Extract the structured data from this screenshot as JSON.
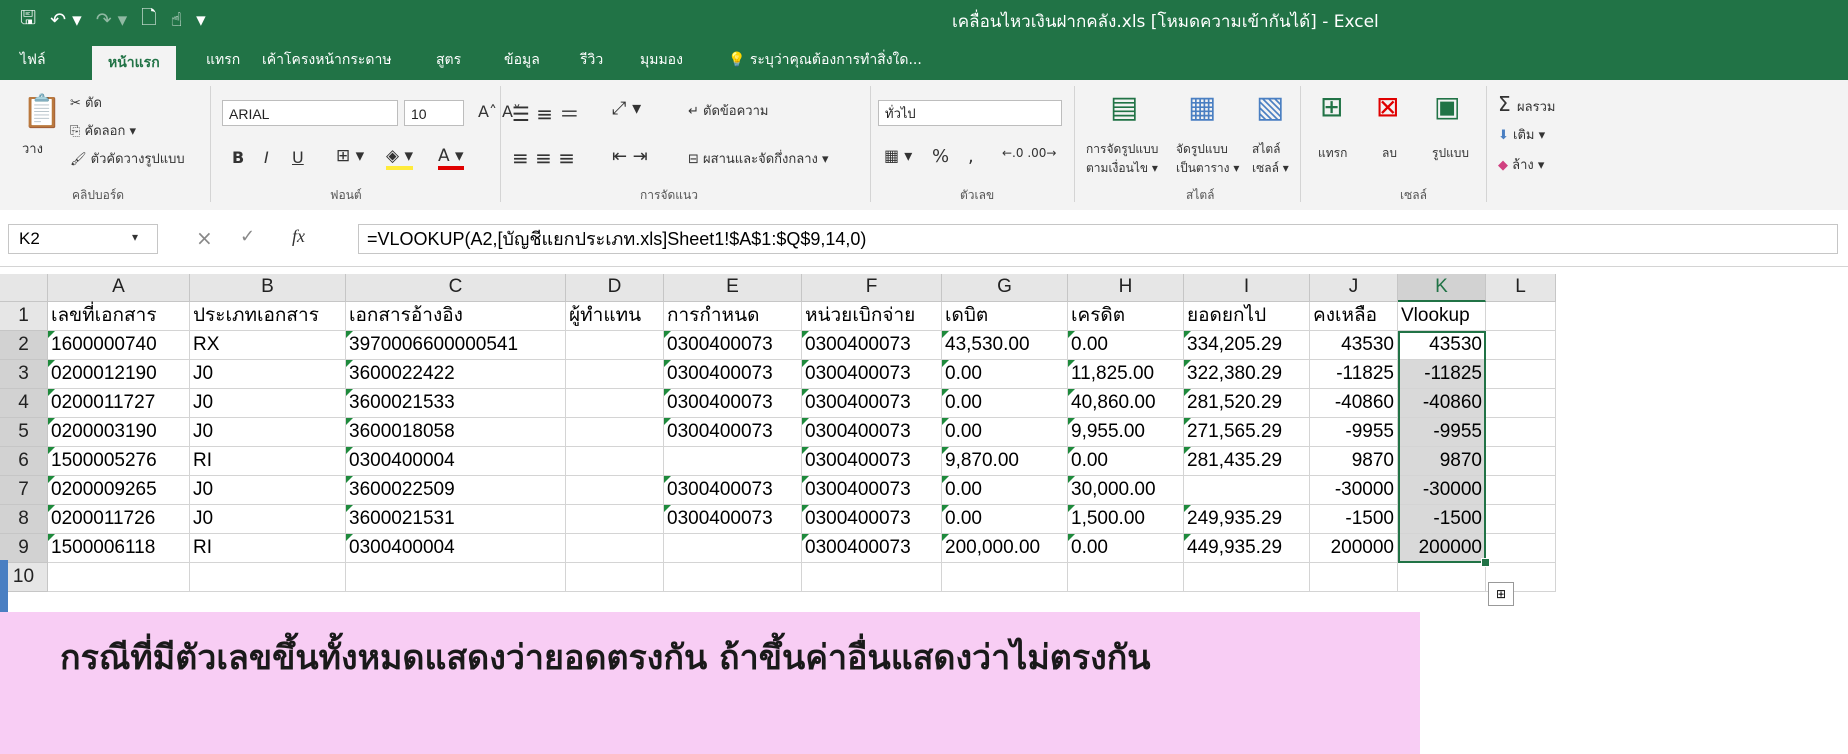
{
  "window": {
    "title": "เคลื่อนไหวเงินฝากคลัง.xls  [โหมดความเข้ากันได้] - Excel",
    "qat_icons": [
      "save-icon",
      "undo-icon",
      "redo-icon",
      "print-preview-icon",
      "touch-mode-icon",
      "customize-icon"
    ]
  },
  "tabs": [
    "ไฟล์",
    "หน้าแรก",
    "แทรก",
    "เค้าโครงหน้ากระดาษ",
    "สูตร",
    "ข้อมูล",
    "รีวิว",
    "มุมมอง"
  ],
  "tell_me": "ระบุว่าคุณต้องการทำสิ่งใด...",
  "ribbon": {
    "clipboard": {
      "paste": "วาง",
      "cut": "ตัด",
      "copy": "คัดลอก",
      "format_painter": "ตัวคัดวางรูปแบบ",
      "label": "คลิปบอร์ด"
    },
    "font": {
      "name": "ARIAL",
      "size": "10",
      "bold": "B",
      "italic": "I",
      "underline": "U",
      "label": "ฟอนต์"
    },
    "alignment": {
      "wrap": "ตัดข้อความ",
      "merge": "ผสานและจัดกึ่งกลาง",
      "label": "การจัดแนว"
    },
    "number": {
      "format": "ทั่วไป",
      "percent": "%",
      "comma": ",",
      "label": "ตัวเลข"
    },
    "styles": {
      "conditional": "การจัดรูปแบบ",
      "conditional2": "ตามเงื่อนไข",
      "table": "จัดรูปแบบ",
      "table2": "เป็นตาราง",
      "cell": "สไตล์",
      "cell2": "เซลล์",
      "label": "สไตล์"
    },
    "cells": {
      "insert": "แทรก",
      "delete": "ลบ",
      "format": "รูปแบบ",
      "label": "เซลล์"
    },
    "editing": {
      "sum": "ผลรวม",
      "fill": "เติม",
      "clear": "ล้าง"
    }
  },
  "formula_bar": {
    "name_box": "K2",
    "cancel": "×",
    "enter": "✓",
    "fx": "fx",
    "formula": "=VLOOKUP(A2,[บัญชีแยกประเภท.xls]Sheet1!$A$1:$Q$9,14,0)"
  },
  "sheet": {
    "columns": [
      "A",
      "B",
      "C",
      "D",
      "E",
      "F",
      "G",
      "H",
      "I",
      "J",
      "K",
      "L"
    ],
    "row_numbers": [
      "1",
      "2",
      "3",
      "4",
      "5",
      "6",
      "7",
      "8",
      "9",
      "10"
    ],
    "headers": [
      "เลขที่เอกสาร",
      "ประเภทเอกสาร",
      "เอกสารอ้างอิง",
      "ผู้ทำแทน",
      "การกำหนด",
      "หน่วยเบิกจ่าย",
      "เดบิต",
      "เครดิต",
      "ยอดยกไป",
      "คงเหลือ",
      "Vlookup"
    ],
    "rows": [
      [
        "1600000740",
        "RX",
        "3970006600000541",
        "",
        "0300400073",
        "0300400073",
        "43,530.00",
        "0.00",
        "334,205.29",
        "43530",
        "43530"
      ],
      [
        "0200012190",
        "J0",
        "3600022422",
        "",
        "0300400073",
        "0300400073",
        "0.00",
        "11,825.00",
        "322,380.29",
        "-11825",
        "-11825"
      ],
      [
        "0200011727",
        "J0",
        "3600021533",
        "",
        "0300400073",
        "0300400073",
        "0.00",
        "40,860.00",
        "281,520.29",
        "-40860",
        "-40860"
      ],
      [
        "0200003190",
        "J0",
        "3600018058",
        "",
        "0300400073",
        "0300400073",
        "0.00",
        "9,955.00",
        "271,565.29",
        "-9955",
        "-9955"
      ],
      [
        "1500005276",
        "RI",
        "0300400004",
        "",
        "",
        "0300400073",
        "9,870.00",
        "0.00",
        "281,435.29",
        "9870",
        "9870"
      ],
      [
        "0200009265",
        "J0",
        "3600022509",
        "",
        "0300400073",
        "0300400073",
        "0.00",
        "30,000.00",
        "",
        "-30000",
        "-30000"
      ],
      [
        "0200011726",
        "J0",
        "3600021531",
        "",
        "0300400073",
        "0300400073",
        "0.00",
        "1,500.00",
        "249,935.29",
        "-1500",
        "-1500"
      ],
      [
        "1500006118",
        "RI",
        "0300400004",
        "",
        "",
        "0300400073",
        "200,000.00",
        "0.00",
        "449,935.29",
        "200000",
        "200000"
      ]
    ]
  },
  "banner": {
    "text": "กรณีที่มีตัวเลขขึ้นทั้งหมดแสดงว่ายอดตรงกัน ถ้าขึ้นค่าอื่นแสดงว่าไม่ตรงกัน"
  },
  "colors": {
    "excel_green": "#217346",
    "banner_pink": "#f8cdf4",
    "selection_gray": "#d9d9d9"
  }
}
